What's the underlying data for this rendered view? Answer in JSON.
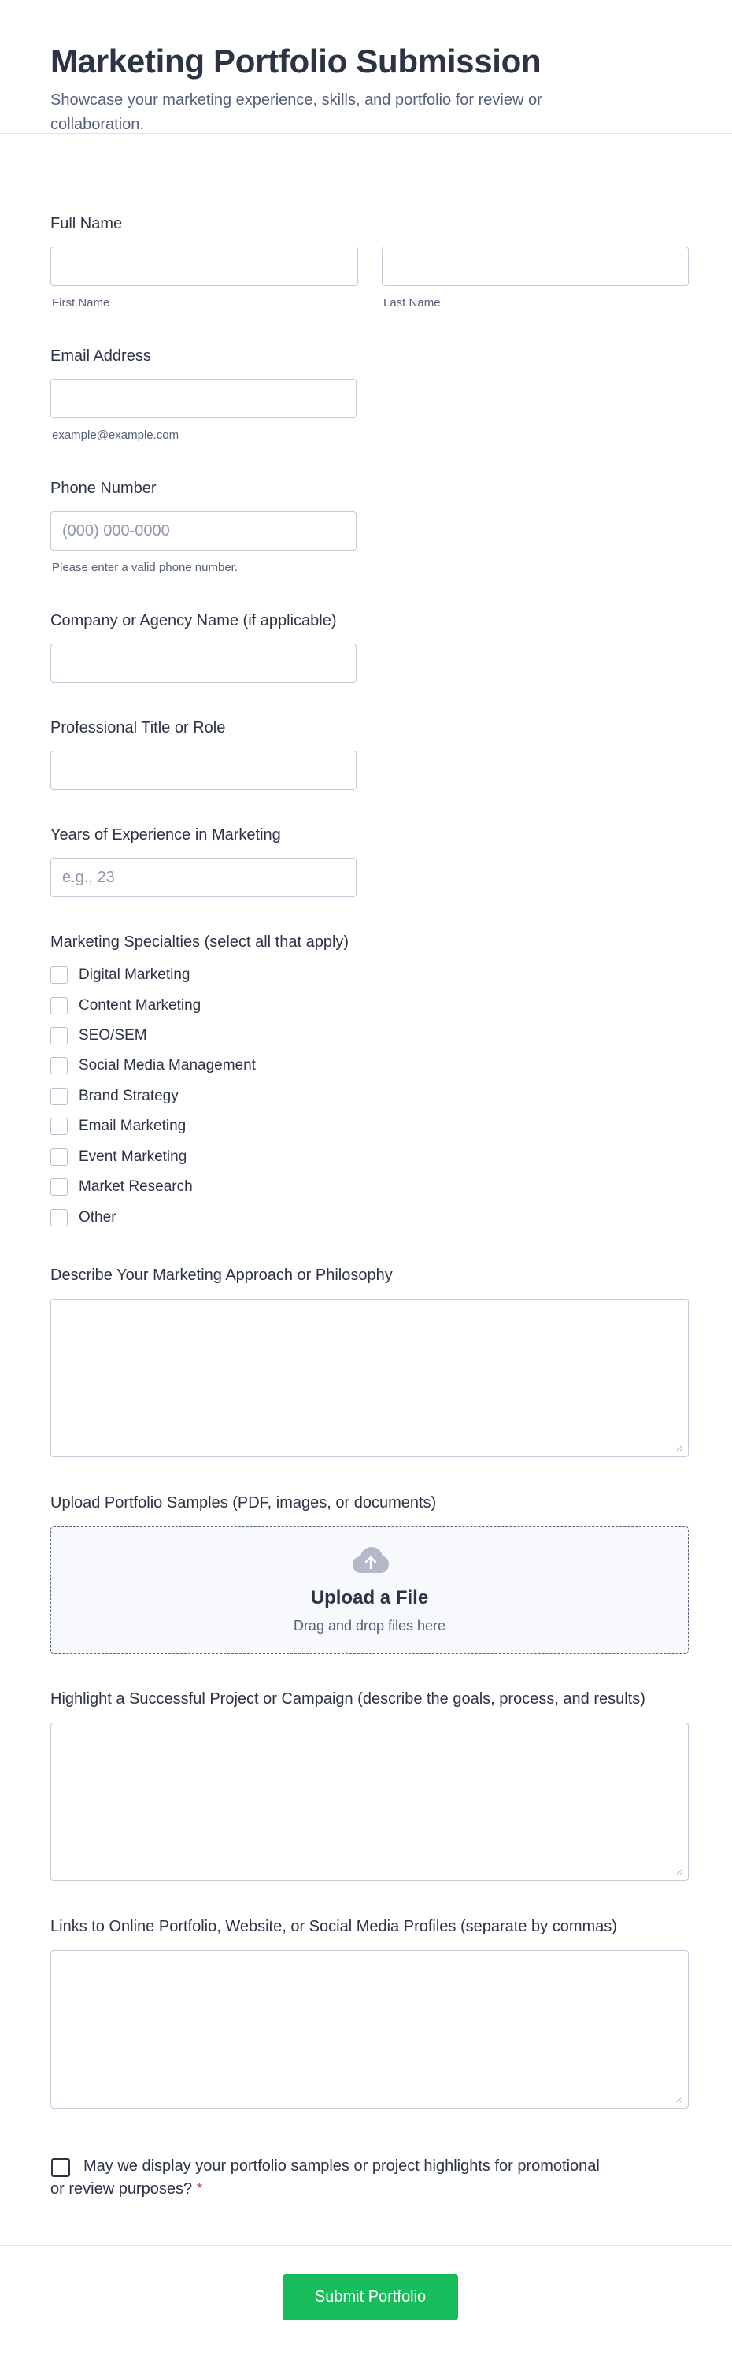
{
  "form": {
    "title": "Marketing Portfolio Submission",
    "subtitle": "Showcase your marketing experience, skills, and portfolio for review or collaboration."
  },
  "full_name": {
    "label": "Full Name",
    "first_sublabel": "First Name",
    "last_sublabel": "Last Name"
  },
  "email": {
    "label": "Email Address",
    "sublabel": "example@example.com"
  },
  "phone": {
    "label": "Phone Number",
    "placeholder": "(000) 000-0000",
    "sublabel": "Please enter a valid phone number."
  },
  "company": {
    "label": "Company or Agency Name (if applicable)"
  },
  "title_role": {
    "label": "Professional Title or Role"
  },
  "experience": {
    "label": "Years of Experience in Marketing",
    "placeholder": "e.g., 23"
  },
  "specialties": {
    "label": "Marketing Specialties (select all that apply)",
    "options": [
      "Digital Marketing",
      "Content Marketing",
      "SEO/SEM",
      "Social Media Management",
      "Brand Strategy",
      "Email Marketing",
      "Event Marketing",
      "Market Research",
      "Other"
    ]
  },
  "approach": {
    "label": "Describe Your Marketing Approach or Philosophy"
  },
  "upload": {
    "label": "Upload Portfolio Samples (PDF, images, or documents)",
    "title": "Upload a File",
    "subtitle": "Drag and drop files here",
    "icon": "cloud-upload-icon"
  },
  "project": {
    "label": "Highlight a Successful Project or Campaign (describe the goals, process, and results)"
  },
  "links": {
    "label": "Links to Online Portfolio, Website, or Social Media Profiles (separate by commas)"
  },
  "consent": {
    "label": "May we display your portfolio samples or project highlights for promotional or review purposes?",
    "required_mark": "*"
  },
  "submit": {
    "label": "Submit Portfolio"
  },
  "colors": {
    "accent": "#18bd5b",
    "required": "#f23a3c",
    "text": "#2c3345"
  }
}
